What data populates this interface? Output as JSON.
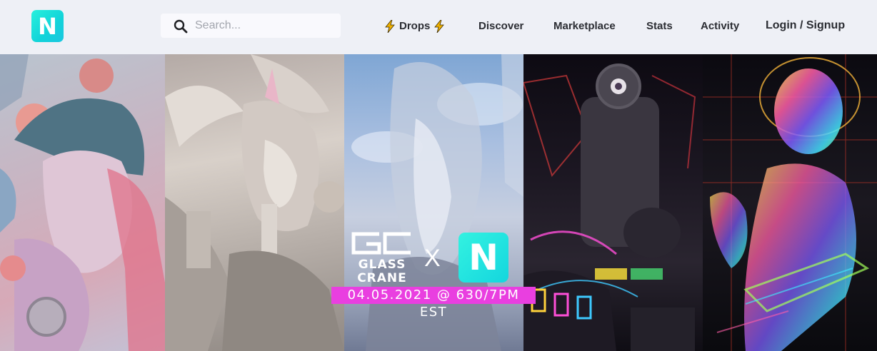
{
  "nav": {
    "logo_letter": "N",
    "search": {
      "placeholder": "Search..."
    },
    "links": {
      "drops": "Drops",
      "discover": "Discover",
      "marketplace": "Marketplace",
      "stats": "Stats",
      "activity": "Activity",
      "login": "Login / Signup"
    }
  },
  "banner": {
    "partner_top": "GC",
    "partner_name_1": "GLASS",
    "partner_name_2": "CRANE",
    "cross": "X",
    "badge_letter": "N",
    "date_text": "04.05.2021 @ 630/7PM EST"
  },
  "colors": {
    "accent_teal": "#1ad6dc",
    "date_magenta": "#e93fe0",
    "bolt": "#f2b300"
  },
  "icons": [
    "search-icon",
    "lightning-bolt-icon"
  ]
}
